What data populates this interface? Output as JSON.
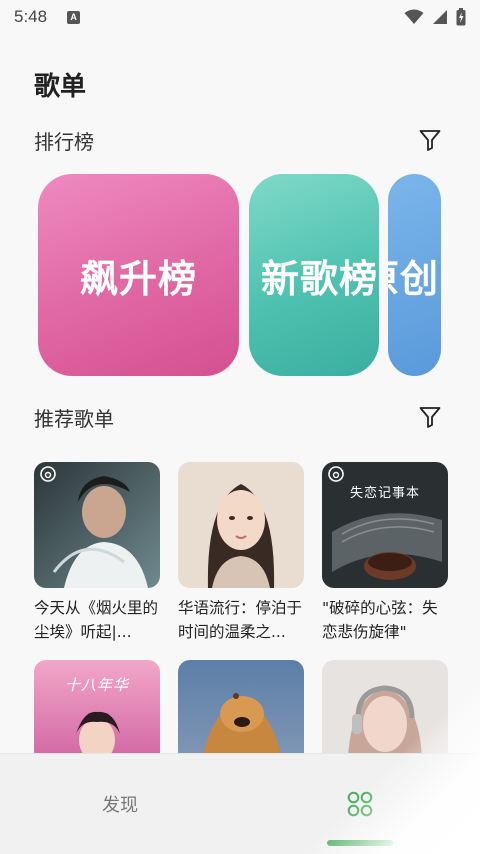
{
  "status_bar": {
    "time": "5:48",
    "notification_letter": "A"
  },
  "page": {
    "title": "歌单"
  },
  "ranking": {
    "title": "排行榜",
    "cards": [
      {
        "label": "飙升榜"
      },
      {
        "label": "新歌榜"
      },
      {
        "label": "原创"
      }
    ]
  },
  "recommended": {
    "title": "推荐歌单",
    "playlists": [
      {
        "title": "今天从《烟火里的尘埃》听起|..."
      },
      {
        "title": "华语流行：停泊于时间的温柔之..."
      },
      {
        "title": "\"破碎的心弦：失恋悲伤旋律\"",
        "cover_text": "失恋记事本"
      },
      {
        "title": "",
        "cover_text": "十八年华"
      },
      {
        "title": ""
      },
      {
        "title": ""
      }
    ]
  },
  "bottom_nav": {
    "tabs": [
      {
        "label": "发现",
        "active": false
      },
      {
        "label": "",
        "icon": "grid-icon",
        "active": true
      }
    ]
  },
  "colors": {
    "accent": "#4cae5f",
    "rank_pink": "#e16aa6",
    "rank_teal": "#4fc1b0",
    "rank_blue": "#5a99db"
  }
}
